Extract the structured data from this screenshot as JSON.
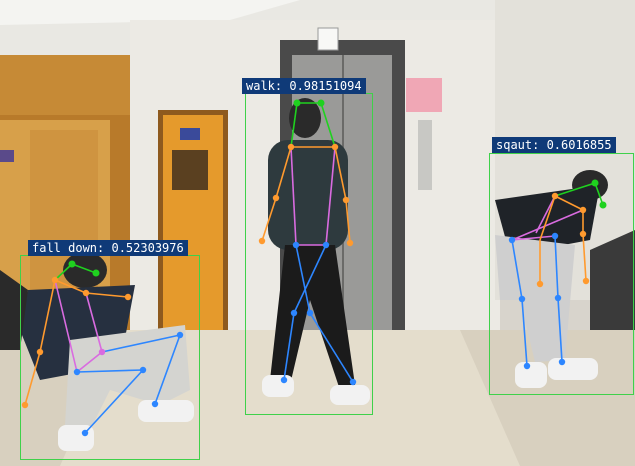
{
  "detections": [
    {
      "id": "walk",
      "label": "walk: 0.98151094",
      "action": "walk",
      "score": 0.98151094
    },
    {
      "id": "squat",
      "label": "sqaut: 0.6016855",
      "action": "sqaut",
      "score": 0.6016855
    },
    {
      "id": "fall",
      "label": "fall down: 0.52303976",
      "action": "fall down",
      "score": 0.52303976
    }
  ],
  "colors": {
    "box": "#3fd14a",
    "label_bg": "#0f3a78",
    "left_limb": "#ff9a2e",
    "right_limb": "#2d86ff",
    "torso": "#d96be0",
    "head": "#1fd11f"
  }
}
